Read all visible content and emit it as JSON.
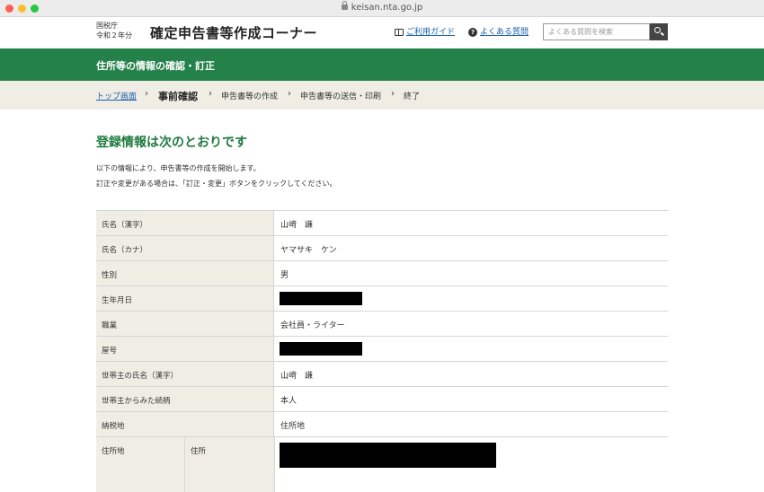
{
  "browser": {
    "url": "keisan.nta.go.jp"
  },
  "header": {
    "agency_line1": "国税庁",
    "agency_line2": "令和２年分",
    "app_title": "確定申告書等作成コーナー",
    "guide_link": "ご利用ガイド",
    "faq_link": "よくある質問",
    "search_placeholder": "よくある質問を検索",
    "search_value": ""
  },
  "band": {
    "title": "住所等の情報の確認・訂正"
  },
  "breadcrumb": {
    "items": [
      {
        "label": "トップ画面"
      },
      {
        "label": "事前確認"
      },
      {
        "label": "申告書等の作成"
      },
      {
        "label": "申告書等の送信・印刷"
      },
      {
        "label": "終了"
      }
    ],
    "separator": "›"
  },
  "main": {
    "heading": "登録情報は次のとおりです",
    "intro_line1": "以下の情報により、申告書等の作成を開始します。",
    "intro_line2": "訂正や変更がある場合は、「訂正・変更」ボタンをクリックしてください。"
  },
  "table": {
    "rows": [
      {
        "label": "氏名（漢字）",
        "value": "山﨑　謙"
      },
      {
        "label": "氏名（カナ）",
        "value": "ヤマサキ　ケン"
      },
      {
        "label": "性別",
        "value": "男"
      },
      {
        "label": "生年月日",
        "value": ""
      },
      {
        "label": "職業",
        "value": "会社員・ライター"
      },
      {
        "label": "屋号",
        "value": ""
      },
      {
        "label": "世帯主の氏名（漢字）",
        "value": "山﨑　謙"
      },
      {
        "label": "世帯主からみた続柄",
        "value": "本人"
      },
      {
        "label": "納税地",
        "value": "住所地"
      }
    ],
    "address": {
      "label": "住所地",
      "sub_label": "住所"
    }
  }
}
